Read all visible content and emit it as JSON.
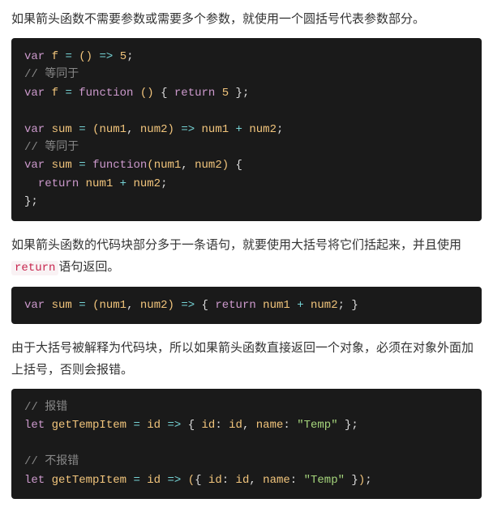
{
  "para1": "如果箭头函数不需要参数或需要多个参数，就使用一个圆括号代表参数部分。",
  "para2_a": "如果箭头函数的代码块部分多于一条语句，就要使用大括号将它们括起来，并且使用",
  "para2_code": "return",
  "para2_b": "语句返回。",
  "para3": "由于大括号被解释为代码块，所以如果箭头函数直接返回一个对象，必须在对象外面加上括号，否则会报错。",
  "code1": {
    "kw": {
      "var": "var",
      "function": "function",
      "return": "return"
    },
    "id": {
      "f": "f",
      "sum": "sum",
      "num1": "num1",
      "num2": "num2"
    },
    "num": {
      "five": "5"
    },
    "op": {
      "eq": "=",
      "arrow": "=>",
      "plus": "+"
    },
    "cm1": "// 等同于",
    "cm2": "// 等同于"
  },
  "code2": {
    "kw": {
      "var": "var",
      "return": "return"
    },
    "id": {
      "sum": "sum",
      "num1": "num1",
      "num2": "num2"
    },
    "op": {
      "eq": "=",
      "arrow": "=>",
      "plus": "+"
    }
  },
  "code3": {
    "kw": {
      "let": "let"
    },
    "id": {
      "getTempItem": "getTempItem",
      "id_param": "id",
      "id_key": "id",
      "id_val": "id",
      "name_key": "name"
    },
    "str": {
      "temp": "\"Temp\""
    },
    "op": {
      "eq": "=",
      "arrow": "=>"
    },
    "cm1": "// 报错",
    "cm2": "// 不报错"
  }
}
